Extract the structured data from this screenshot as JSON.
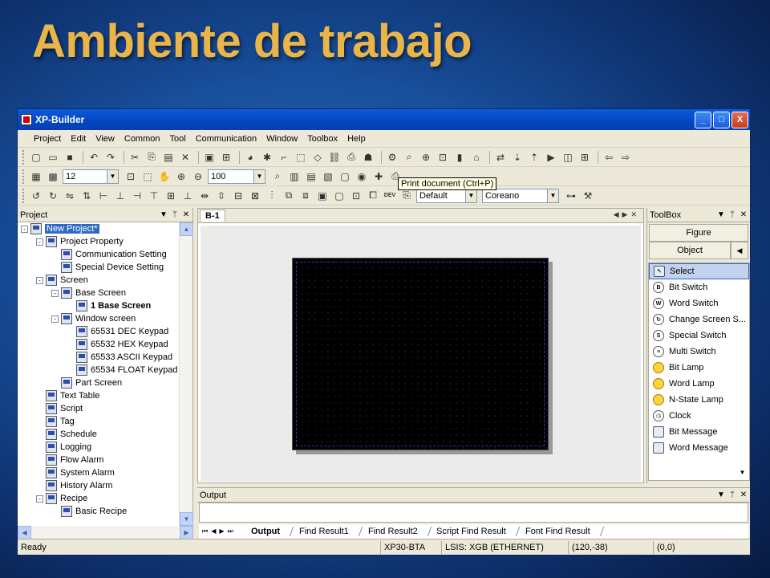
{
  "slide": {
    "title": "Ambiente de trabajo"
  },
  "window": {
    "title": "XP-Builder",
    "controls": {
      "minimize": "_",
      "maximize": "□",
      "close": "X"
    }
  },
  "menu": [
    "Project",
    "Edit",
    "View",
    "Common",
    "Tool",
    "Communication",
    "Window",
    "Toolbox",
    "Help"
  ],
  "toolbar": {
    "grid_size": "12",
    "zoom": "100",
    "tooltip": "Print document (Ctrl+P)",
    "style_select": "Default",
    "language_select": "Coreano",
    "dev_label": "DEV"
  },
  "project_panel": {
    "title": "Project",
    "tree": [
      {
        "label": "New Project*",
        "level": 0,
        "toggle": "-",
        "selected": true
      },
      {
        "label": "Project Property",
        "level": 1,
        "toggle": "-"
      },
      {
        "label": "Communication Setting",
        "level": 2
      },
      {
        "label": "Special Device Setting",
        "level": 2
      },
      {
        "label": "Screen",
        "level": 1,
        "toggle": "-"
      },
      {
        "label": "Base Screen",
        "level": 2,
        "toggle": "-"
      },
      {
        "label": "1 Base Screen",
        "level": 3,
        "bold": true
      },
      {
        "label": "Window screen",
        "level": 2,
        "toggle": "-"
      },
      {
        "label": "65531 DEC Keypad",
        "level": 3
      },
      {
        "label": "65532 HEX Keypad",
        "level": 3
      },
      {
        "label": "65533 ASCII Keypad",
        "level": 3
      },
      {
        "label": "65534 FLOAT Keypad",
        "level": 3
      },
      {
        "label": "Part Screen",
        "level": 2
      },
      {
        "label": "Text Table",
        "level": 1
      },
      {
        "label": "Script",
        "level": 1
      },
      {
        "label": "Tag",
        "level": 1
      },
      {
        "label": "Schedule",
        "level": 1
      },
      {
        "label": "Logging",
        "level": 1
      },
      {
        "label": "Flow Alarm",
        "level": 1
      },
      {
        "label": "System Alarm",
        "level": 1
      },
      {
        "label": "History Alarm",
        "level": 1
      },
      {
        "label": "Recipe",
        "level": 1,
        "toggle": "-"
      },
      {
        "label": "Basic Recipe",
        "level": 2
      }
    ]
  },
  "editor": {
    "tab_label": "B-1"
  },
  "output_panel": {
    "title": "Output",
    "tabs": [
      "Output",
      "Find Result1",
      "Find Result2",
      "Script Find Result",
      "Font Find Result"
    ],
    "active_tab": "Output"
  },
  "toolbox": {
    "title": "ToolBox",
    "categories": {
      "figure": "Figure",
      "object": "Object"
    },
    "items": [
      {
        "label": "Select",
        "icon": "cursor-icon",
        "glyph": "↖",
        "selected": true
      },
      {
        "label": "Bit Switch",
        "icon": "bit-switch-icon",
        "glyph": "B"
      },
      {
        "label": "Word Switch",
        "icon": "word-switch-icon",
        "glyph": "W"
      },
      {
        "label": "Change Screen S...",
        "icon": "change-screen-icon",
        "glyph": "↻"
      },
      {
        "label": "Special Switch",
        "icon": "special-switch-icon",
        "glyph": "S"
      },
      {
        "label": "Multi Switch",
        "icon": "multi-switch-icon",
        "glyph": "≡"
      },
      {
        "label": "Bit Lamp",
        "icon": "bulb-icon",
        "glyph": ""
      },
      {
        "label": "Word Lamp",
        "icon": "bulb-icon",
        "glyph": ""
      },
      {
        "label": "N-State Lamp",
        "icon": "bulb-icon",
        "glyph": ""
      },
      {
        "label": "Clock",
        "icon": "clock-icon",
        "glyph": "◷"
      },
      {
        "label": "Bit Message",
        "icon": "message-icon",
        "glyph": ""
      },
      {
        "label": "Word Message",
        "icon": "message-icon",
        "glyph": ""
      }
    ]
  },
  "status_bar": {
    "state": "Ready",
    "device": "XP30-BTA",
    "plc": "LSIS: XGB (ETHERNET)",
    "cursor": "(120,-38)",
    "size": "(0,0)"
  }
}
